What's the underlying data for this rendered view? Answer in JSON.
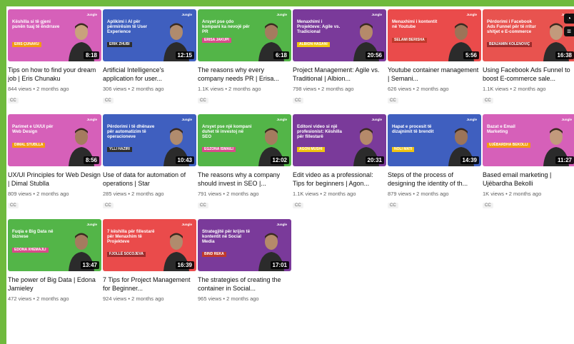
{
  "videos": [
    {
      "title": "Tips on how to find your dream job | Eris Chunaku",
      "views": "844 views • 2 months ago",
      "cc": "CC",
      "duration": "8:18",
      "thumb_title": "Këshilla si të gjeni punën tuaj të ëndrrave",
      "name_tag": "ERIS ÇUNAKU",
      "brand": "Jungle",
      "color": "#d660b9",
      "tagcolor": "#f39c12",
      "avatar": "#c9a27c"
    },
    {
      "title": "Artificial Intelligence's application for user...",
      "views": "306 views • 2 months ago",
      "cc": "CC",
      "duration": "12:15",
      "thumb_title": "Aplikimi i AI për përmirësim të User Experience",
      "name_tag": "ERIK ZHUBI",
      "brand": "Jungle",
      "color": "#3f5fbf",
      "tagcolor": "#2d2d2d",
      "avatar": "#b08b6d"
    },
    {
      "title": "The reasons why every company needs PR | Erisa...",
      "views": "1.1K views • 2 months ago",
      "cc": "CC",
      "duration": "6:18",
      "thumb_title": "Arsyet pse çdo kompani ka nevojë për PR",
      "name_tag": "ERISA JAKUPI",
      "brand": "Jungle",
      "color": "#53b548",
      "tagcolor": "#d94b8a",
      "avatar": "#a57b5f"
    },
    {
      "title": "Project Management: Agile vs. Traditional | Albion...",
      "views": "798 views • 2 months ago",
      "cc": "CC",
      "duration": "20:56",
      "thumb_title": "Menaxhimi i Projekteve: Agile vs. Tradicional",
      "name_tag": "ALBION HASANI",
      "brand": "Jungle",
      "color": "#7a3a9a",
      "tagcolor": "#f1c40f",
      "avatar": "#b58a6a"
    },
    {
      "title": "Youtube container management | Semani...",
      "views": "626 views • 2 months ago",
      "cc": "CC",
      "duration": "5:56",
      "thumb_title": "Menaxhimi i kontentit në Youtube",
      "name_tag": "SELAMI BERISHA",
      "brand": "Jungle",
      "color": "#ea4b4b",
      "tagcolor": "#c0392b",
      "avatar": "#9c7458"
    },
    {
      "title": "Using Facebook Ads Funnel to boost E-commerce sale...",
      "views": "1.1K views • 2 months ago",
      "cc": "CC",
      "duration": "16:38",
      "thumb_title": "Përdorimi i Facebook Ads Funnel për të rritur shitjet e E-commerce",
      "name_tag": "BENJAMIN KOLENOVIÇ",
      "brand": "Jungle",
      "color": "#e8534f",
      "tagcolor": "#9b2c2c",
      "avatar": "#c29a7c"
    },
    {
      "title": "UX/UI Principles for Web Design | Dimal Stublla",
      "views": "809 views • 2 months ago",
      "cc": "CC",
      "duration": "8:56",
      "thumb_title": "Parimet e UX/UI për Web Design",
      "name_tag": "DIMAL STUBLLA",
      "brand": "Jungle",
      "color": "#d660b9",
      "tagcolor": "#f39c12",
      "avatar": "#a57b5f"
    },
    {
      "title": "Use of data for automation of operations | Star",
      "views": "285 views • 2 months ago",
      "cc": "CC",
      "duration": "10:43",
      "thumb_title": "Përdorimi i të dhënave për automatizim të operacioneve",
      "name_tag": "YLLI HAZIRI",
      "brand": "Jungle",
      "color": "#3f5fbf",
      "tagcolor": "#2d2d2d",
      "avatar": "#b08b6d"
    },
    {
      "title": "The reasons why a company should invest in SEO |...",
      "views": "791 views • 2 months ago",
      "cc": "CC",
      "duration": "12:02",
      "thumb_title": "Arsyet pse një kompani duhet të investoj në SEO",
      "name_tag": "EGZONA ISMAILI",
      "brand": "Jungle",
      "color": "#53b548",
      "tagcolor": "#d94b8a",
      "avatar": "#a57b5f"
    },
    {
      "title": "Edit video as a professional: Tips for beginners | Agon...",
      "views": "1.1K views • 2 months ago",
      "cc": "CC",
      "duration": "20:31",
      "thumb_title": "Editoni video si një profesionist: Këshilla për fillestarë",
      "name_tag": "AGON MUSHI",
      "brand": "Jungle",
      "color": "#7a3a9a",
      "tagcolor": "#f1c40f",
      "avatar": "#b58a6a"
    },
    {
      "title": "Steps of the process of designing the identity of th...",
      "views": "879 views • 2 months ago",
      "cc": "CC",
      "duration": "14:39",
      "thumb_title": "Hapat e procesit të dizajnimit të brendit",
      "name_tag": "NOLI MATI",
      "brand": "Jungle",
      "color": "#3f5fbf",
      "tagcolor": "#f1c40f",
      "avatar": "#9c7458"
    },
    {
      "title": "Based email marketing | Ujëbardha Bekolli",
      "views": "1K views • 2 months ago",
      "cc": "CC",
      "duration": "11:27",
      "thumb_title": "Bazat e Email Marketing",
      "name_tag": "UJËBARDHA BEKOLLI",
      "brand": "Jungle",
      "color": "#d660b9",
      "tagcolor": "#f39c12",
      "avatar": "#c29a7c"
    },
    {
      "title": "The power of Big Data | Edona Jamieley",
      "views": "472 views • 2 months ago",
      "cc": "",
      "duration": "13:47",
      "thumb_title": "Fuqia e Big Data në biznese",
      "name_tag": "EDONA XHEMAJLI",
      "brand": "Jungle",
      "color": "#53b548",
      "tagcolor": "#d94b8a",
      "avatar": "#a57b5f"
    },
    {
      "title": "7 Tips for Project Management for Beginner...",
      "views": "924 views • 2 months ago",
      "cc": "",
      "duration": "16:39",
      "thumb_title": "7 këshilla për fillestarë për Menaxhim të Projekteve",
      "name_tag": "FJOLLË SOCOJEVA",
      "brand": "Jungle",
      "color": "#ea4b4b",
      "tagcolor": "#9b2c2c",
      "avatar": "#b08b6d"
    },
    {
      "title": "The strategies of creating the container in Social...",
      "views": "965 views • 2 months ago",
      "cc": "",
      "duration": "17:01",
      "thumb_title": "Strategjitë për krijim të kontentit në Social Media",
      "name_tag": "BIND REKA",
      "brand": "Jungle",
      "color": "#7a3a9a",
      "tagcolor": "#c0392b",
      "avatar": "#b58a6a"
    }
  ],
  "side_buttons": [
    {
      "icon": "clock-icon",
      "label": "◔"
    },
    {
      "icon": "playlist-add-icon",
      "label": "≡"
    }
  ],
  "kebab": "⋮"
}
